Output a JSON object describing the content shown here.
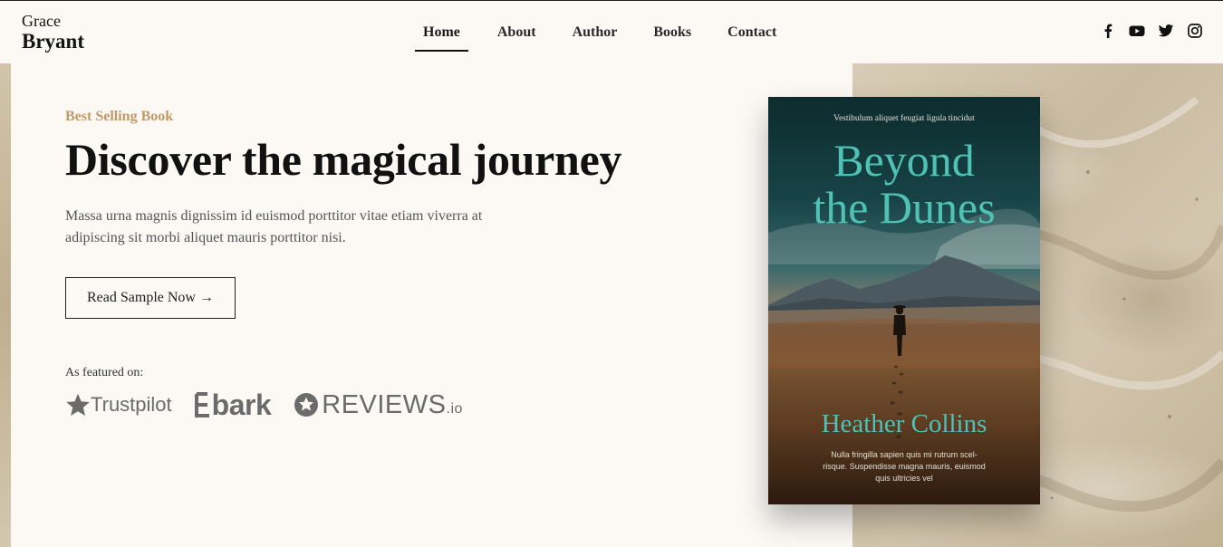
{
  "header": {
    "logo_first": "Grace",
    "logo_last": "Bryant",
    "nav": [
      {
        "label": "Home",
        "active": true
      },
      {
        "label": "About",
        "active": false
      },
      {
        "label": "Author",
        "active": false
      },
      {
        "label": "Books",
        "active": false
      },
      {
        "label": "Contact",
        "active": false
      }
    ],
    "social_icons": [
      "facebook-icon",
      "youtube-icon",
      "twitter-icon",
      "instagram-icon"
    ]
  },
  "hero": {
    "eyebrow": "Best Selling Book",
    "title": "Discover the magical journey",
    "description": "Massa urna magnis dignissim id euismod porttitor vitae etiam viverra at adipiscing sit morbi aliquet mauris porttitor nisi.",
    "cta_label": "Read Sample Now →",
    "featured_label": "As featured on:",
    "featured_logos": [
      {
        "name": "trustpilot",
        "text": "Trustpilot"
      },
      {
        "name": "bark",
        "text": "bark"
      },
      {
        "name": "reviews-io",
        "text": "REVIEWS",
        "suffix": ".io"
      }
    ]
  },
  "book": {
    "tagline": "Vestibulum aliquet feugiat ligula tincidut",
    "title_line1": "Beyond",
    "title_line2": "the Dunes",
    "author": "Heather Collins",
    "blurb": "Nulla fringilla sapien quis mi rutrum scel-risque. Suspendisse magna mauris, euismod quis ultricies vel"
  },
  "colors": {
    "background": "#fcf9f5",
    "accent": "#c29a66",
    "book_title": "#4fc1b5",
    "text": "#141414",
    "muted": "#555555"
  }
}
